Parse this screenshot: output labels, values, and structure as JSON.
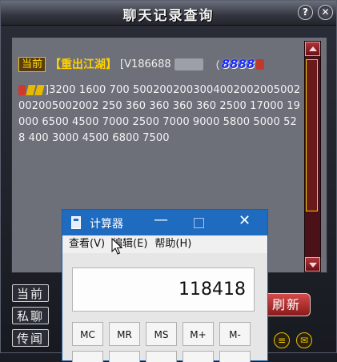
{
  "game_window": {
    "title": "聊天记录查询",
    "help_label": "?",
    "close_label": "✕"
  },
  "message": {
    "channel": "当前",
    "server": "【重出江湖】",
    "player": "[V186688",
    "paren": "（",
    "fancy_number": "8888",
    "body_prefix": "]",
    "body": "3200 1600 700 5002002003004002002005002002005002002 250 360 360 360 360 2500 17000 19000 6500 4500 7000 2500 7000 9000 5800 5000 528 400 3000 4500 6800 7500"
  },
  "channel_buttons": [
    {
      "label": "当前"
    },
    {
      "label": "私聊"
    },
    {
      "label": "传闻"
    }
  ],
  "refresh_label": "刷新",
  "calculator": {
    "title": "计算器",
    "menu": [
      "查看(V)",
      "编辑(E)",
      "帮助(H)"
    ],
    "display_value": "118418",
    "memory_buttons": [
      "MC",
      "MR",
      "MS",
      "M+",
      "M-"
    ]
  },
  "colors": {
    "accent_gold": "#ffd200",
    "calc_title_blue": "#1e6bc0",
    "scroll_red": "#6a1016"
  }
}
